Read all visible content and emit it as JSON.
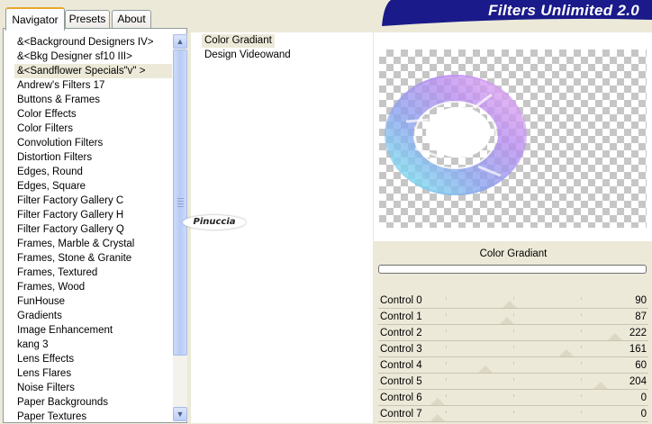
{
  "tabs": [
    {
      "label": "Navigator",
      "active": true
    },
    {
      "label": "Presets",
      "active": false
    },
    {
      "label": "About",
      "active": false
    }
  ],
  "title": "Filters Unlimited 2.0",
  "categories": [
    "&<Background Designers IV>",
    "&<Bkg Designer sf10 III>",
    "&<Sandflower Specials\"v\" >",
    "Andrew's Filters 17",
    "Buttons & Frames",
    "Color Effects",
    "Color Filters",
    "Convolution Filters",
    "Distortion Filters",
    "Edges, Round",
    "Edges, Square",
    "Filter Factory Gallery C",
    "Filter Factory Gallery H",
    "Filter Factory Gallery Q",
    "Frames, Marble & Crystal",
    "Frames, Stone & Granite",
    "Frames, Textured",
    "Frames, Wood",
    "FunHouse",
    "Gradients",
    "Image Enhancement",
    "kang 3",
    "Lens Effects",
    "Lens Flares",
    "Noise Filters",
    "Paper Backgrounds",
    "Paper Textures"
  ],
  "selected_category_index": 2,
  "filters": [
    "Color Gradiant",
    "Design Videowand"
  ],
  "selected_filter_index": 0,
  "watermark": "Pinuccia",
  "current_filter": "Color Gradiant",
  "controls": [
    {
      "label": "Control 0",
      "value": 90
    },
    {
      "label": "Control 1",
      "value": 87
    },
    {
      "label": "Control 2",
      "value": 222
    },
    {
      "label": "Control 3",
      "value": 161
    },
    {
      "label": "Control 4",
      "value": 60
    },
    {
      "label": "Control 5",
      "value": 204
    },
    {
      "label": "Control 6",
      "value": 0
    },
    {
      "label": "Control 7",
      "value": 0
    }
  ],
  "control_max": 255,
  "colors": {
    "banner": "#1a1a8a",
    "window": "#ece9d8",
    "selection": "#ece9d8"
  },
  "icons": {
    "scroll_up": "chevron-up-icon",
    "scroll_down": "chevron-down-icon"
  }
}
